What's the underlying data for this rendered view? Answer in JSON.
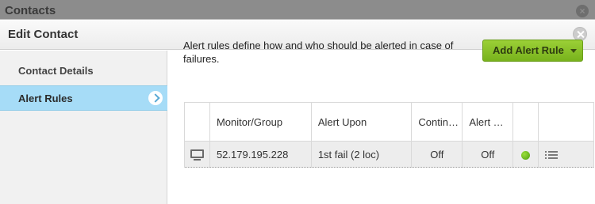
{
  "background_window": {
    "title": "Contacts"
  },
  "dialog": {
    "title": "Edit Contact"
  },
  "sidebar": {
    "items": [
      {
        "label": "Contact Details",
        "selected": false
      },
      {
        "label": "Alert Rules",
        "selected": true
      }
    ]
  },
  "main": {
    "description": "Alert rules define how and who should be alerted in case of failures.",
    "add_button_label": "Add Alert Rule"
  },
  "table": {
    "headers": [
      "",
      "Monitor/Group",
      "Alert Upon",
      "Contin…",
      "Alert …",
      "",
      ""
    ],
    "rows": [
      {
        "monitor": "52.179.195.228",
        "alert_upon": "1st fail (2 loc)",
        "continuous": "Off",
        "alert": "Off",
        "status_color": "#6cc11f"
      }
    ]
  },
  "colors": {
    "accent_green": "#8cc52a",
    "sidebar_selected": "#a6dcf7"
  }
}
